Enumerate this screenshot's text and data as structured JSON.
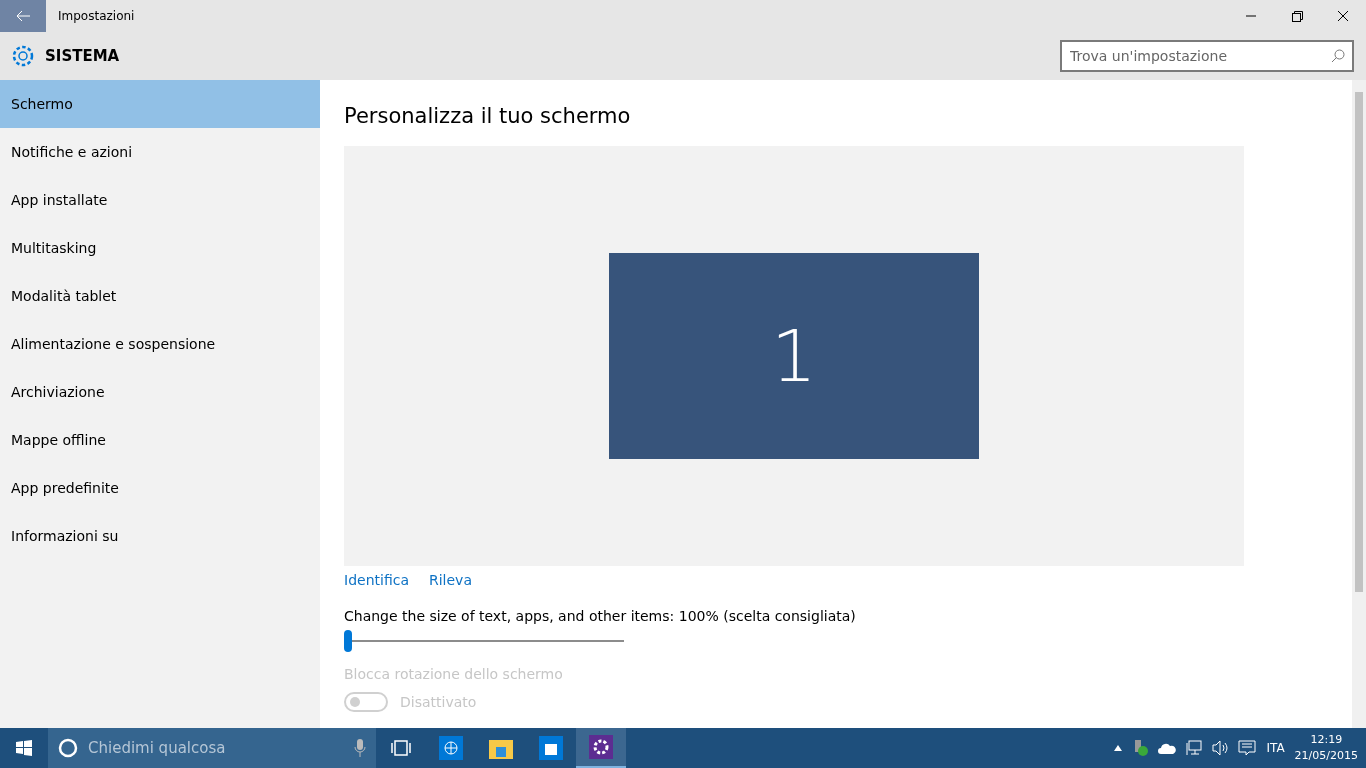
{
  "window": {
    "title": "Impostazioni"
  },
  "header": {
    "title": "SISTEMA"
  },
  "search": {
    "placeholder": "Trova un'impostazione"
  },
  "sidebar": {
    "items": [
      {
        "label": "Schermo",
        "selected": true
      },
      {
        "label": "Notifiche e azioni",
        "selected": false
      },
      {
        "label": "App installate",
        "selected": false
      },
      {
        "label": "Multitasking",
        "selected": false
      },
      {
        "label": "Modalità tablet",
        "selected": false
      },
      {
        "label": "Alimentazione e sospensione",
        "selected": false
      },
      {
        "label": "Archiviazione",
        "selected": false
      },
      {
        "label": "Mappe offline",
        "selected": false
      },
      {
        "label": "App predefinite",
        "selected": false
      },
      {
        "label": "Informazioni su",
        "selected": false
      }
    ]
  },
  "content": {
    "title": "Personalizza il tuo schermo",
    "monitor_label": "1",
    "links": [
      "Identifica",
      "Rileva"
    ],
    "scale": {
      "label": "Change the size of text, apps, and other items: 100% (scelta consigliata)",
      "level": 0
    },
    "rotation_lock": {
      "label": "Blocca rotazione dello schermo",
      "on": false,
      "disabled": true,
      "state_text": "Disattivato"
    }
  },
  "taskbar": {
    "search_placeholder": "Chiedimi qualcosa",
    "apps": [
      {
        "kind": "browser",
        "selected": false
      },
      {
        "kind": "folder",
        "selected": false
      },
      {
        "kind": "store",
        "selected": false
      },
      {
        "kind": "settings",
        "selected": true
      }
    ],
    "language": "ITA",
    "time": "12:19",
    "date": "21/05/2015"
  }
}
